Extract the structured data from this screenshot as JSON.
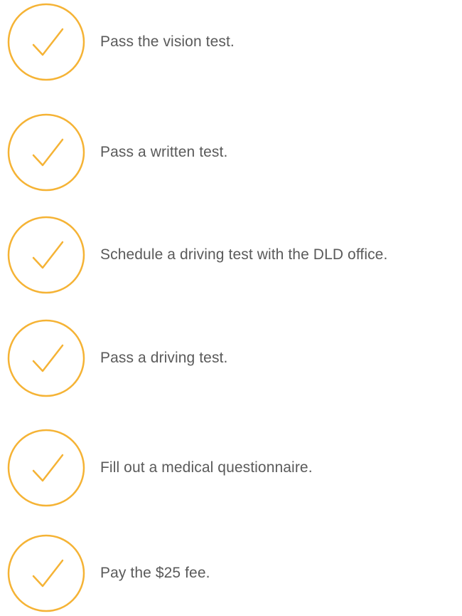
{
  "accent_color": "#f5b335",
  "text_color": "#5a5a5a",
  "items": [
    {
      "icon": "check-circle-icon",
      "label": "Pass the vision test."
    },
    {
      "icon": "check-circle-icon",
      "label": "Pass a written test."
    },
    {
      "icon": "check-circle-icon",
      "label": "Schedule a driving test with the DLD office."
    },
    {
      "icon": "check-circle-icon",
      "label": "Pass a driving test."
    },
    {
      "icon": "check-circle-icon",
      "label": "Fill out a medical questionnaire."
    },
    {
      "icon": "check-circle-icon",
      "label": "Pay the $25 fee."
    }
  ]
}
